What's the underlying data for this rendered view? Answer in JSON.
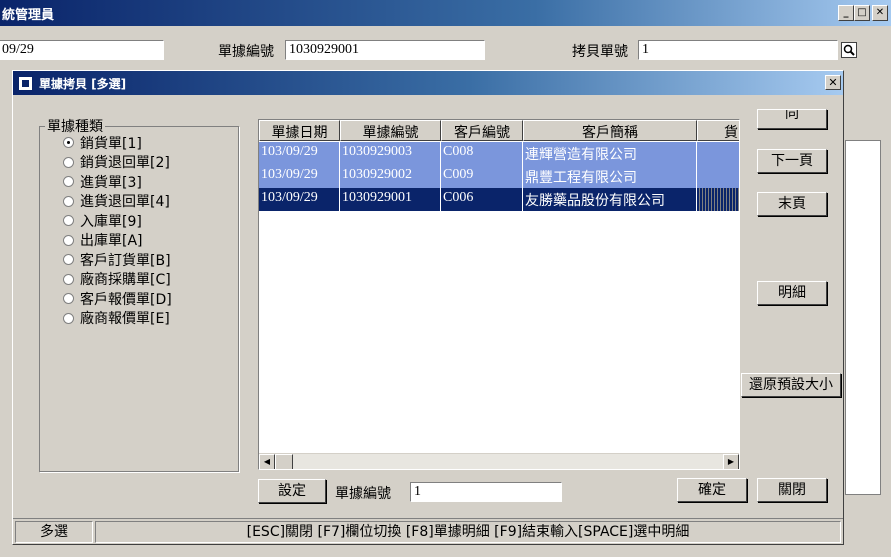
{
  "main": {
    "title": "統管理員",
    "date_value": "09/29",
    "doc_no_label": "單據編號",
    "doc_no_value": "1030929001",
    "copy_no_label": "拷貝單號",
    "copy_no_value": "1"
  },
  "dialog": {
    "title": "單據拷貝 [多選]",
    "group_title": "單據種類",
    "doc_types": [
      {
        "label": "銷貨單[1]",
        "selected": true
      },
      {
        "label": "銷貨退回單[2]",
        "selected": false
      },
      {
        "label": "進貨單[3]",
        "selected": false
      },
      {
        "label": "進貨退回單[4]",
        "selected": false
      },
      {
        "label": "入庫單[9]",
        "selected": false
      },
      {
        "label": "出庫單[A]",
        "selected": false
      },
      {
        "label": "客戶訂貨單[B]",
        "selected": false
      },
      {
        "label": "廠商採購單[C]",
        "selected": false
      },
      {
        "label": "客戶報價單[D]",
        "selected": false
      },
      {
        "label": "廠商報價單[E]",
        "selected": false
      }
    ],
    "columns": [
      "單據日期",
      "單據編號",
      "客戶編號",
      "客戶簡稱",
      "貨"
    ],
    "rows": [
      {
        "date": "103/09/29",
        "no": "1030929003",
        "cust": "C008",
        "name": "連輝營造有限公司",
        "current": false
      },
      {
        "date": "103/09/29",
        "no": "1030929002",
        "cust": "C009",
        "name": "鼎豐工程有限公司",
        "current": false
      },
      {
        "date": "103/09/29",
        "no": "1030929001",
        "cust": "C006",
        "name": "友勝藥品股份有限公司",
        "current": true
      }
    ],
    "buttons": {
      "prev_partial": "同",
      "next_page": "下一頁",
      "last_page": "末頁",
      "detail": "明細",
      "restore_size": "還原預設大小",
      "setup": "設定",
      "confirm": "確定",
      "close": "關閉"
    },
    "search_label": "單據編號",
    "search_value": "1",
    "status_mode": "多選",
    "status_hint": "[ESC]關閉 [F7]欄位切換 [F8]單據明細 [F9]結束輸入[SPACE]選中明細"
  },
  "colors": {
    "selected_row": "#7b96dc",
    "current_row": "#0a246a",
    "title_bar": "#0a246a"
  }
}
